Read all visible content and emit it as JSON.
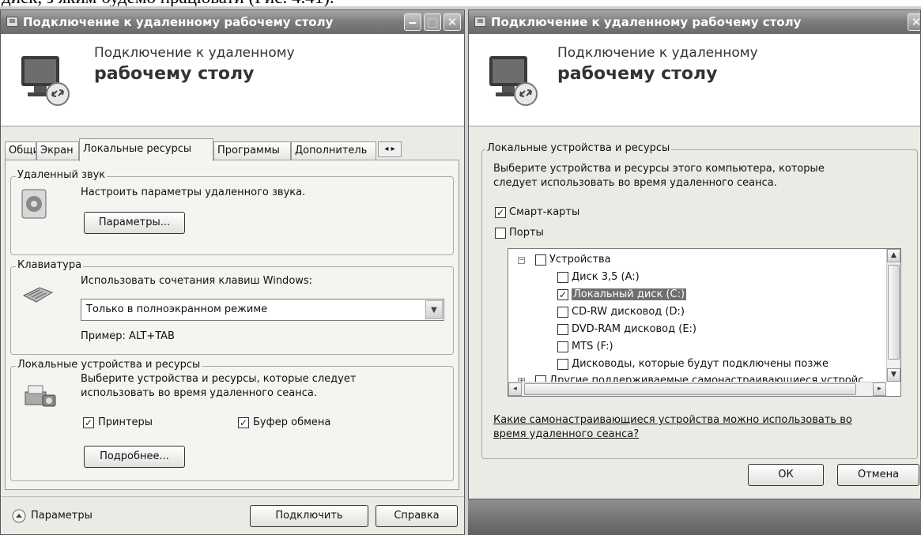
{
  "caption": "диск, з яким будемо працювати (Рис. 4.41).",
  "left_window": {
    "title": "Подключение к удаленному рабочему столу",
    "banner_line1": "Подключение к удаленному",
    "banner_line2": "рабочему столу",
    "tabs": [
      "Общие",
      "Экран",
      "Локальные ресурсы",
      "Программы",
      "Дополнитель"
    ],
    "active_tab": "Локальные ресурсы",
    "sound_group": {
      "title": "Удаленный звук",
      "description": "Настроить параметры удаленного звука.",
      "button": "Параметры..."
    },
    "keyboard_group": {
      "title": "Клавиатура",
      "description": "Использовать сочетания клавиш Windows:",
      "selected": "Только в полноэкранном режиме",
      "example": "Пример: ALT+TAB"
    },
    "local_group": {
      "title": "Локальные устройства и ресурсы",
      "description_line1": "Выберите устройства и ресурсы, которые следует",
      "description_line2": "использовать во время удаленного сеанса.",
      "printers": "Принтеры",
      "clipboard": "Буфер обмена",
      "printers_checked": true,
      "clipboard_checked": true,
      "button": "Подробнее..."
    },
    "footer": {
      "options": "Параметры",
      "connect": "Подключить",
      "help": "Справка"
    }
  },
  "right_window": {
    "title": "Подключение к удаленному рабочему столу",
    "banner_line1": "Подключение к удаленному",
    "banner_line2": "рабочему столу",
    "group_title": "Локальные устройства и ресурсы",
    "description_line1": "Выберите устройства и ресурсы этого компьютера, которые",
    "description_line2": "следует использовать во время удаленного сеанса.",
    "smartcards": "Смарт-карты",
    "smartcards_checked": true,
    "ports": "Порты",
    "ports_checked": false,
    "tree": [
      {
        "label": "Устройства",
        "checked": false,
        "level": 0,
        "expander": "−"
      },
      {
        "label": "Диск 3,5 (A:)",
        "checked": false,
        "level": 1
      },
      {
        "label": "Локальный диск (C:)",
        "checked": true,
        "level": 1
      },
      {
        "label": "CD-RW дисковод (D:)",
        "checked": false,
        "level": 1
      },
      {
        "label": "DVD-RAM дисковод (E:)",
        "checked": false,
        "level": 1
      },
      {
        "label": "MTS (F:)",
        "checked": false,
        "level": 1
      },
      {
        "label": "Дисководы, которые будут подключены позже",
        "checked": false,
        "level": 1
      },
      {
        "label": "Другие поддерживаемые самонастраивающиеся устройс",
        "checked": false,
        "level": 0,
        "expander": "+"
      }
    ],
    "link_line1": "Какие самонастраивающиеся устройства можно использовать во",
    "link_line2": "время удаленного сеанса?",
    "ok": "ОК",
    "cancel": "Отмена"
  },
  "check_mark": "✓"
}
